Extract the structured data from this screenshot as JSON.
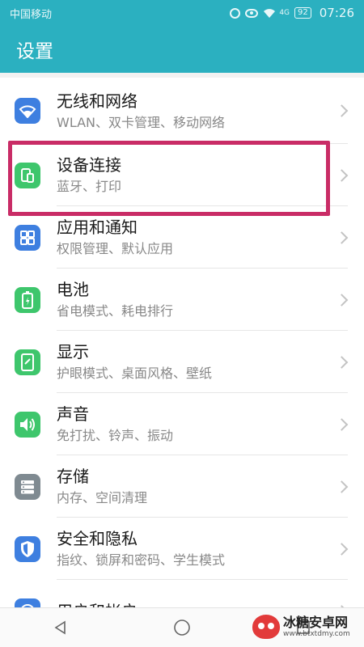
{
  "status_bar": {
    "carrier": "中国移动",
    "network": "4G",
    "battery": "92",
    "time": "07:26"
  },
  "app_bar": {
    "title": "设置"
  },
  "colors": {
    "accent": "#2bb0c0",
    "highlight": "#c92c66",
    "icon_blue": "#3e7fe0",
    "icon_green": "#3ec66c",
    "icon_gray": "#7f8a91"
  },
  "settings": [
    {
      "title": "无线和网络",
      "subtitle": "WLAN、双卡管理、移动网络",
      "icon": "wifi-icon"
    },
    {
      "title": "设备连接",
      "subtitle": "蓝牙、打印",
      "icon": "device-connection-icon"
    },
    {
      "title": "应用和通知",
      "subtitle": "权限管理、默认应用",
      "icon": "apps-icon"
    },
    {
      "title": "电池",
      "subtitle": "省电模式、耗电排行",
      "icon": "battery-icon"
    },
    {
      "title": "显示",
      "subtitle": "护眼模式、桌面风格、壁纸",
      "icon": "display-icon"
    },
    {
      "title": "声音",
      "subtitle": "免打扰、铃声、振动",
      "icon": "sound-icon"
    },
    {
      "title": "存储",
      "subtitle": "内存、空间清理",
      "icon": "storage-icon"
    },
    {
      "title": "安全和隐私",
      "subtitle": "指纹、锁屏和密码、学生模式",
      "icon": "security-icon"
    },
    {
      "title": "用户和帐户",
      "subtitle": "",
      "icon": "user-icon"
    }
  ],
  "watermark": {
    "name": "冰糖安卓网",
    "url": "www.btxtdmy.com"
  }
}
